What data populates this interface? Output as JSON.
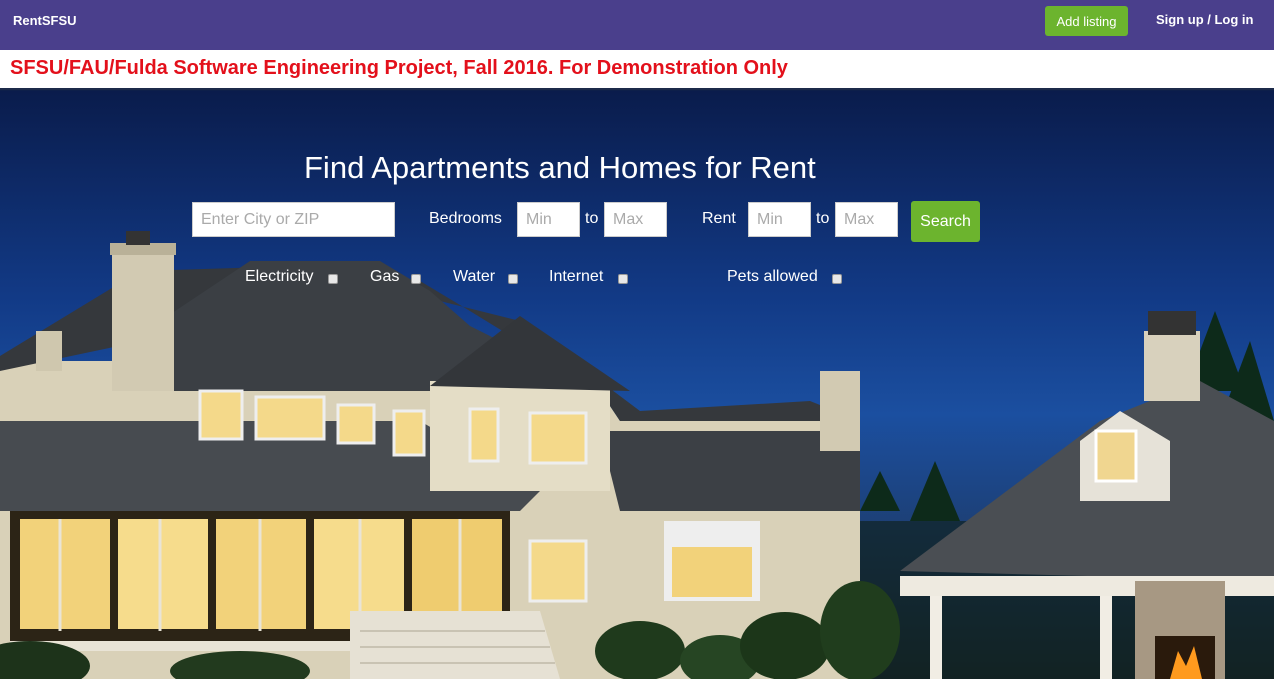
{
  "navbar": {
    "brand": "RentSFSU",
    "add_listing_label": "Add listing",
    "signin_label": "Sign up / Log in"
  },
  "banner": {
    "text": "SFSU/FAU/Fulda Software Engineering Project, Fall 2016. For Demonstration Only"
  },
  "hero": {
    "title": "Find Apartments and Homes for Rent",
    "location_placeholder": "Enter City or ZIP",
    "bedrooms_label": "Bedrooms",
    "rent_label": "Rent",
    "to_label": "to",
    "min_placeholder": "Min",
    "max_placeholder": "Max",
    "search_label": "Search",
    "amenities": {
      "electricity": "Electricity",
      "gas": "Gas",
      "water": "Water",
      "internet": "Internet",
      "pets": "Pets allowed"
    }
  },
  "colors": {
    "navbar": "#4a3f8c",
    "accent_green": "#6cb42e",
    "banner_red": "#e3101b"
  }
}
